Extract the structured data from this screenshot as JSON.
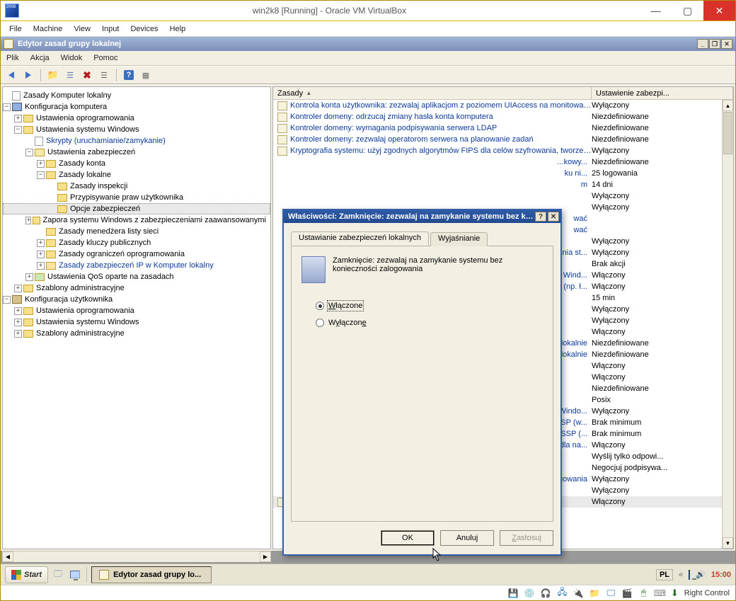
{
  "virtualbox": {
    "appicon_caption": "2008",
    "title_text": "win2k8 [Running] - Oracle VM VirtualBox",
    "menu": {
      "file": "File",
      "machine": "Machine",
      "view": "View",
      "input": "Input",
      "devices": "Devices",
      "help": "Help"
    },
    "winbtns": {
      "min": "—",
      "max": "▢",
      "close": "✕"
    },
    "status": {
      "hard_disk_icon": "💾",
      "optical_icon": "💿",
      "usb_icon": "🔌",
      "audio_icon": "🎧",
      "net_icon": "🖧",
      "shared_icon": "📁",
      "display_icon": "🖵",
      "video_icon": "🎬",
      "mouse_icon": "🖱",
      "kb_icon": "⌨",
      "hostkey_hint": "⬇",
      "hostkey": "Right Control"
    }
  },
  "gp": {
    "title": "Edytor zasad grupy lokalnej",
    "winctl": {
      "min": "_",
      "restore": "❐",
      "close": "✕"
    },
    "menu": {
      "plik": "Plik",
      "akcja": "Akcja",
      "widok": "Widok",
      "pomoc": "Pomoc"
    },
    "toolbar": {
      "back": "←",
      "forward": "→",
      "up": "⇧",
      "sep": "",
      "list": "☰",
      "x": "✖",
      "props": "☑",
      "help": "?",
      "view": "▦"
    },
    "tree": {
      "root": "Zasady Komputer lokalny",
      "comp_conf": "Konfiguracja komputera",
      "soft1": "Ustawienia oprogramowania",
      "winset": "Ustawienia systemu Windows",
      "scripts": "Skrypty (uruchamianie/zamykanie)",
      "sec": "Ustawienia zabezpieczeń",
      "acct": "Zasady konta",
      "local": "Zasady lokalne",
      "audit": "Zasady inspekcji",
      "ura": "Przypisywanie praw użytkownika",
      "secopts": "Opcje zabezpieczeń",
      "firewall": "Zapora systemu Windows z zabezpieczeniami zaawansowanymi",
      "nlm": "Zasady menedżera listy sieci",
      "pubkey": "Zasady kluczy publicznych",
      "srp": "Zasady ograniczeń oprogramowania",
      "ipsec": "Zasady zabezpieczeń IP w Komputer lokalny",
      "qos": "Ustawienia QoS oparte na zasadach",
      "admin1": "Szablony administracyjne",
      "user_conf": "Konfiguracja użytkownika",
      "soft2": "Ustawienia oprogramowania",
      "winset2": "Ustawienia systemu Windows",
      "admin2": "Szablony administracyjne"
    },
    "list_header": {
      "policy": "Zasady",
      "setting": "Ustawienie zabezpi..."
    },
    "rows": [
      {
        "name": "Kontrola konta użytkownika: zezwalaj aplikacjom z poziomem UIAccess na monitowanie o p...",
        "val": "Wyłączony"
      },
      {
        "name": "Kontroler domeny: odrzucaj zmiany hasła konta komputera",
        "val": "Niezdefiniowane"
      },
      {
        "name": "Kontroler domeny: wymagania podpisywania serwera LDAP",
        "val": "Niezdefiniowane"
      },
      {
        "name": "Kontroler domeny: zezwalaj operatorom serwera na planowanie zadań",
        "val": "Niezdefiniowane"
      },
      {
        "name": "Kryptografia systemu: użyj zgodnych algorytmów FIPS dla celów szyfrowania, tworzenia s...",
        "val": "Wyłączony"
      },
      {
        "name": "",
        "val": "Niezdefiniowane",
        "partial": true,
        "suffix": "...kowy..."
      },
      {
        "name": "",
        "val": "25 logowania",
        "partial": true,
        "suffix": "ku ni..."
      },
      {
        "name": "",
        "val": "14 dni",
        "partial": true,
        "suffix": "m"
      },
      {
        "name": "",
        "val": "Wyłączony",
        "partial": true
      },
      {
        "name": "",
        "val": "Wyłączony",
        "partial": true
      },
      {
        "name": "",
        "val": "",
        "partial": true,
        "suffix": "wać"
      },
      {
        "name": "",
        "val": "",
        "partial": true,
        "suffix": "wać"
      },
      {
        "name": "",
        "val": "Wyłączony",
        "partial": true
      },
      {
        "name": "",
        "val": "Wyłączony",
        "partial": true,
        "suffix": "ania st..."
      },
      {
        "name": "",
        "val": "Brak akcji",
        "partial": true
      },
      {
        "name": "",
        "val": "Włączony",
        "partial": true,
        "suffix": "ż Wind..."
      },
      {
        "name": "",
        "val": "Włączony",
        "partial": true,
        "suffix": "(np. ł..."
      },
      {
        "name": "",
        "val": "15 min",
        "partial": true
      },
      {
        "name": "",
        "val": "Wyłączony",
        "partial": true
      },
      {
        "name": "",
        "val": "Wyłączony",
        "partial": true
      },
      {
        "name": "",
        "val": "Włączony",
        "partial": true
      },
      {
        "name": "",
        "val": "Niezdefiniowane",
        "partial": true,
        "suffix": "lokalnie"
      },
      {
        "name": "",
        "val": "Niezdefiniowane",
        "partial": true,
        "suffix": "o lokalnie"
      },
      {
        "name": "",
        "val": "Włączony",
        "partial": true
      },
      {
        "name": "",
        "val": "Włączony",
        "partial": true
      },
      {
        "name": "",
        "val": "Niezdefiniowane",
        "partial": true
      },
      {
        "name": "",
        "val": "Posix",
        "partial": true
      },
      {
        "name": "",
        "val": "Wyłączony",
        "partial": true,
        "suffix": "Windo..."
      },
      {
        "name": "",
        "val": "Brak minimum",
        "partial": true,
        "suffix": "SSP (w..."
      },
      {
        "name": "",
        "val": "Brak minimum",
        "partial": true,
        "suffix": "ł SSP (..."
      },
      {
        "name": "",
        "val": "Włączony",
        "partial": true,
        "suffix": "dla na..."
      },
      {
        "name": "",
        "val": "Wyślij tylko odpowi...",
        "partial": true
      },
      {
        "name": "",
        "val": "Negocjuj podpisywa...",
        "partial": true
      },
      {
        "name": "",
        "val": "Wyłączony",
        "partial": true,
        "suffix": "gowania"
      },
      {
        "name": "",
        "val": "Wyłączony",
        "partial": true
      },
      {
        "name": "Zamknięcie: zezwalaj na zamykanie systemu bez konieczności zalogowania",
        "val": "Włączony",
        "selected": true
      }
    ]
  },
  "modal": {
    "title": "Właściwości: Zamknięcie: zezwalaj na zamykanie systemu bez ko...",
    "help": "?",
    "close": "✕",
    "tab_local": "Ustawianie zabezpieczeń lokalnych",
    "tab_explain": "Wyjaśnianie",
    "policy_desc": "Zamknięcie: zezwalaj na zamykanie systemu bez konieczności zalogowania",
    "opt_enabled": "Włączone",
    "opt_disabled": "Wyłączone",
    "btn_ok": "OK",
    "btn_cancel": "Anuluj",
    "btn_apply": "Zastosuj"
  },
  "taskbar": {
    "start": "Start",
    "task_label": "Edytor zasad grupy lo...",
    "lang": "PL",
    "time": "15:00"
  }
}
